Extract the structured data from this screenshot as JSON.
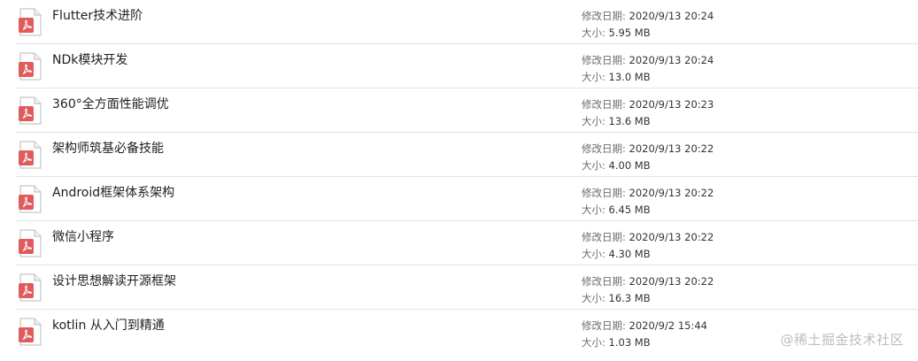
{
  "files": [
    {
      "name": "Flutter技术进阶",
      "date_label": "修改日期:",
      "date": "2020/9/13 20:24",
      "size_label": "大小:",
      "size": "5.95 MB",
      "icon": "pdf-file-icon"
    },
    {
      "name": "NDk模块开发",
      "date_label": "修改日期:",
      "date": "2020/9/13 20:24",
      "size_label": "大小:",
      "size": "13.0 MB",
      "icon": "pdf-file-icon"
    },
    {
      "name": "360°全方面性能调优",
      "date_label": "修改日期:",
      "date": "2020/9/13 20:23",
      "size_label": "大小:",
      "size": "13.6 MB",
      "icon": "pdf-file-icon"
    },
    {
      "name": "架构师筑基必备技能",
      "date_label": "修改日期:",
      "date": "2020/9/13 20:22",
      "size_label": "大小:",
      "size": "4.00 MB",
      "icon": "pdf-file-icon"
    },
    {
      "name": "Android框架体系架构",
      "date_label": "修改日期:",
      "date": "2020/9/13 20:22",
      "size_label": "大小:",
      "size": "6.45 MB",
      "icon": "pdf-file-icon"
    },
    {
      "name": "微信小程序",
      "date_label": "修改日期:",
      "date": "2020/9/13 20:22",
      "size_label": "大小:",
      "size": "4.30 MB",
      "icon": "pdf-file-icon"
    },
    {
      "name": "设计思想解读开源框架",
      "date_label": "修改日期:",
      "date": "2020/9/13 20:22",
      "size_label": "大小:",
      "size": "16.3 MB",
      "icon": "pdf-file-icon"
    },
    {
      "name": "kotlin 从入门到精通",
      "date_label": "修改日期:",
      "date": "2020/9/2 15:44",
      "size_label": "大小:",
      "size": "1.03 MB",
      "icon": "pdf-file-icon"
    }
  ],
  "watermark": "@稀土掘金技术社区",
  "colors": {
    "pdf_badge": "#e05c5c",
    "separator": "#e3e3e3",
    "label": "#6d6d6d"
  }
}
